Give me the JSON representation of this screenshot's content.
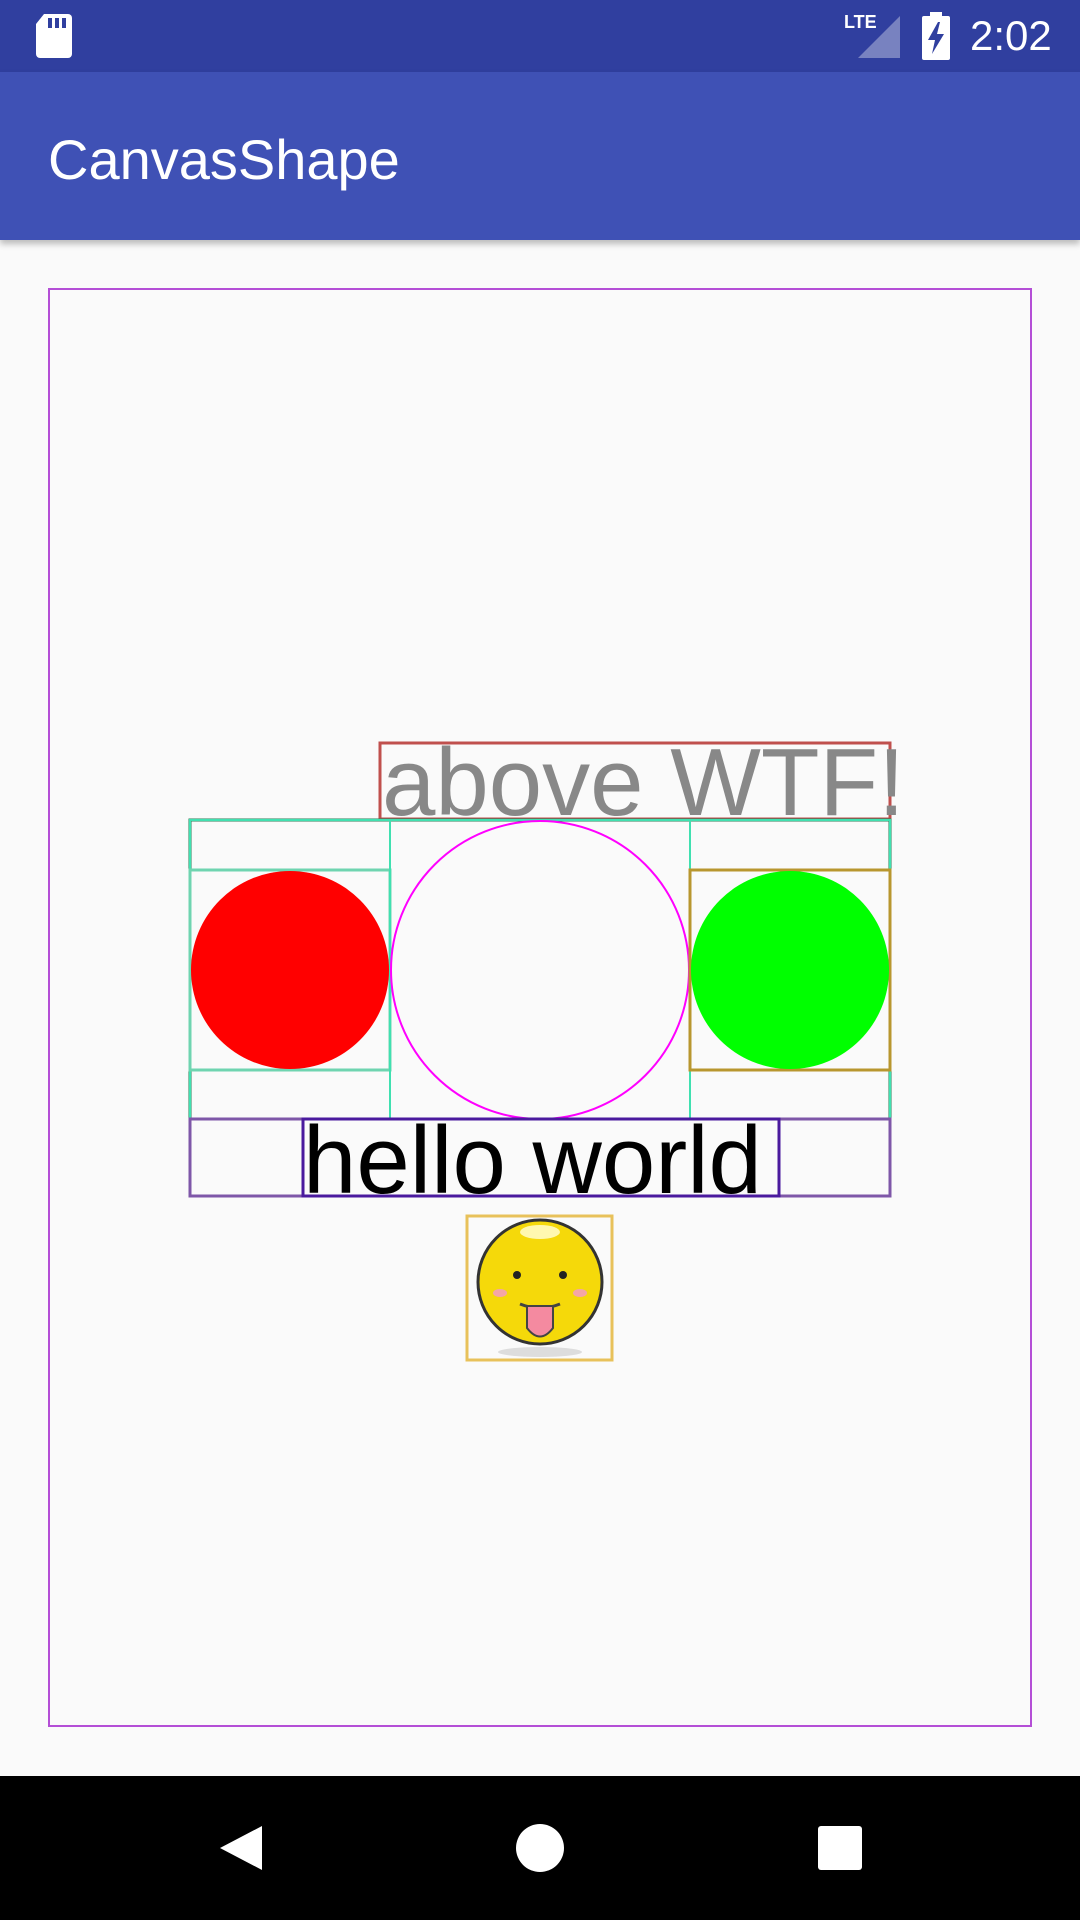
{
  "status_bar": {
    "time": "2:02",
    "network_label": "LTE",
    "icons": [
      "sd-card-icon",
      "lte-signal-icon",
      "battery-charging-icon"
    ]
  },
  "app_bar": {
    "title": "CanvasShape"
  },
  "canvas": {
    "top_text": "above WTF!",
    "bottom_text": "hello world",
    "colors": {
      "left_circle": "#ff0000",
      "right_circle": "#00ff00",
      "middle_circle_stroke": "#ff00ff",
      "outer_frame": "#b44ed6",
      "top_text": "#888888",
      "bottom_text": "#000000"
    },
    "emoji_icon": "tongue-out-smiley-icon"
  },
  "nav_bar": {
    "buttons": [
      "back-icon",
      "home-icon",
      "recents-icon"
    ]
  }
}
